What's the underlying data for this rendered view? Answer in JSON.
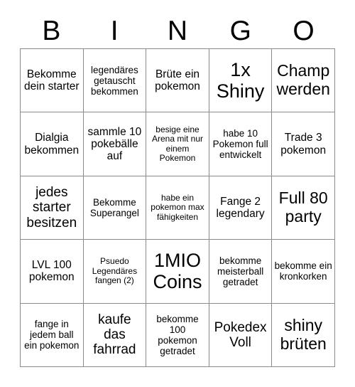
{
  "card": {
    "title": "BINGO",
    "header_letters": [
      "B",
      "I",
      "N",
      "G",
      "O"
    ],
    "colors": {
      "background": "#ffffff",
      "text": "#000000",
      "grid_line": "#8a8a8a"
    },
    "grid_size": "5x5",
    "rows": [
      [
        {
          "text": "Bekomme dein starter",
          "size": "fs-md"
        },
        {
          "text": "legendäres getauscht bekommen",
          "size": "fs-sm"
        },
        {
          "text": "Brüte ein pokemon",
          "size": "fs-md"
        },
        {
          "text": "1x Shiny",
          "size": "fs-xxl"
        },
        {
          "text": "Champ werden",
          "size": "fs-xl"
        }
      ],
      [
        {
          "text": "Dialgia bekommen",
          "size": "fs-md"
        },
        {
          "text": "sammle 10 pokebälle auf",
          "size": "fs-md"
        },
        {
          "text": "besige eine Arena mit nur einem Pokemon",
          "size": "fs-xs"
        },
        {
          "text": "habe 10 Pokemon full entwickelt",
          "size": "fs-sm"
        },
        {
          "text": "Trade 3 pokemon",
          "size": "fs-md"
        }
      ],
      [
        {
          "text": "jedes starter besitzen",
          "size": "fs-lg"
        },
        {
          "text": "Bekomme Superangel",
          "size": "fs-sm"
        },
        {
          "text": "habe ein pokemon max fähigkeiten",
          "size": "fs-xs"
        },
        {
          "text": "Fange 2 legendary",
          "size": "fs-md"
        },
        {
          "text": "Full 80 party",
          "size": "fs-xl"
        }
      ],
      [
        {
          "text": "LVL 100 pokemon",
          "size": "fs-md"
        },
        {
          "text": "Psuedo Legendäres fangen (2)",
          "size": "fs-xs"
        },
        {
          "text": "1MIO Coins",
          "size": "fs-xxl"
        },
        {
          "text": "bekomme meisterball getradet",
          "size": "fs-sm"
        },
        {
          "text": "bekomme ein kronkorken",
          "size": "fs-sm"
        }
      ],
      [
        {
          "text": "fange in jedem ball ein pokemon",
          "size": "fs-sm"
        },
        {
          "text": "kaufe das fahrrad",
          "size": "fs-lg"
        },
        {
          "text": "bekomme 100 pokemon getradet",
          "size": "fs-sm"
        },
        {
          "text": "Pokedex Voll",
          "size": "fs-lg"
        },
        {
          "text": "shiny brüten",
          "size": "fs-xl"
        }
      ]
    ]
  }
}
